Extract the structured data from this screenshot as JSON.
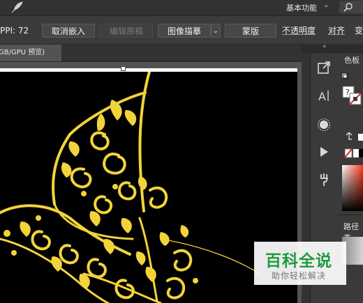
{
  "top_bar": {
    "workspace": "基本功能",
    "search_icon": "search-icon"
  },
  "control_bar": {
    "ppi_label": "PPI: 72",
    "unembed_button": "取消嵌入",
    "edit_original_button": "编辑原稿",
    "image_trace_button": "图像描摹",
    "mask_button": "蒙版",
    "opacity_label": "不透明度",
    "align_label": "对齐",
    "transform_label_partial": "变"
  },
  "document_tab": {
    "label_partial": "GB/GPU 预览)"
  },
  "panel": {
    "swatches_title": "色板",
    "path_title_partial": "路径查"
  },
  "watermark": {
    "title": "百科全说",
    "subtitle": "助你轻松解决"
  },
  "colors": {
    "artwork_gold": "#f2d43a",
    "artboard": "#000000",
    "ui_dark": "#323232",
    "watermark_green": "#1f9b3f"
  }
}
